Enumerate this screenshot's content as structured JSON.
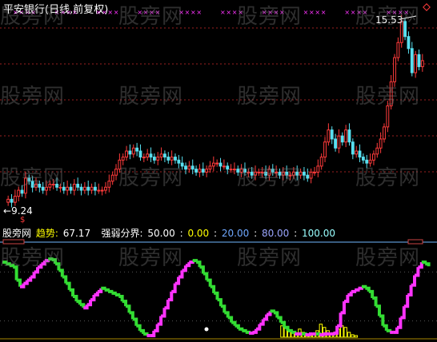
{
  "header": {
    "title": "平安银行(日线,前复权)"
  },
  "price": {
    "high_label": "15.53",
    "low_label": "9.24"
  },
  "indicator": {
    "source_label": "股旁网",
    "trend_label": "趋势:",
    "trend_value": "67.17",
    "bound_label": "强弱分界:",
    "levels": [
      "50.00",
      "0.00",
      "20.00",
      "80.00",
      "100.00"
    ],
    "sep": ":"
  },
  "watermark": "股旁网",
  "colors": {
    "up": "#ff3b3b",
    "down": "#58e0f0",
    "grid": "#9b1f1f",
    "magenta": "#ff33ff",
    "green": "#33dd33",
    "yellow": "#ffff00",
    "blue_level": "#6fa8ff",
    "cyan_level": "#99ffff"
  },
  "chart_data": [
    {
      "type": "candlestick",
      "title": "平安银行(日线,前复权)",
      "ylim": [
        9.0,
        16.0
      ],
      "annotations": [
        "15.53",
        "9.24"
      ],
      "close": [
        9.6,
        9.5,
        9.7,
        9.9,
        9.8,
        10.3,
        10.2,
        10.0,
        10.1,
        10.0,
        9.9,
        10.0,
        10.1,
        10.1,
        10.0,
        10.0,
        9.9,
        10.0,
        9.9,
        10.1,
        10.0,
        9.9,
        10.0,
        9.9,
        10.0,
        9.9,
        9.9,
        9.9,
        10.0,
        10.2,
        10.4,
        10.6,
        10.9,
        11.0,
        11.2,
        11.1,
        11.3,
        11.2,
        11.0,
        11.0,
        11.1,
        11.0,
        10.9,
        11.0,
        11.1,
        11.0,
        10.9,
        11.0,
        10.9,
        10.8,
        10.7,
        10.6,
        10.7,
        10.6,
        10.5,
        10.6,
        10.5,
        10.6,
        10.7,
        10.8,
        10.8,
        10.7,
        10.7,
        10.6,
        10.6,
        10.6,
        10.5,
        10.6,
        10.5,
        10.5,
        10.4,
        10.5,
        10.5,
        10.5,
        10.4,
        10.6,
        10.5,
        10.5,
        10.4,
        10.5,
        10.4,
        10.4,
        10.5,
        10.4,
        10.5,
        10.4,
        10.3,
        10.5,
        10.5,
        10.7,
        11.0,
        11.5,
        11.9,
        11.6,
        11.3,
        11.7,
        11.5,
        11.9,
        11.5,
        11.1,
        11.2,
        11.0,
        10.9,
        10.8,
        10.9,
        11.1,
        11.3,
        11.6,
        12.0,
        12.7,
        13.5,
        14.3,
        14.8,
        15.5,
        15.0,
        14.6,
        13.8,
        14.4,
        14.0,
        14.2
      ]
    },
    {
      "type": "line",
      "title": "趋势",
      "ylim": [
        0,
        100
      ],
      "series": [
        {
          "name": "趋势",
          "values": [
            92,
            90,
            88,
            86,
            70,
            62,
            66,
            70,
            74,
            80,
            86,
            90,
            94,
            96,
            95,
            90,
            82,
            74,
            66,
            58,
            50,
            44,
            40,
            36,
            40,
            46,
            52,
            56,
            60,
            58,
            56,
            54,
            52,
            50,
            44,
            38,
            30,
            22,
            14,
            8,
            4,
            2,
            2,
            8,
            16,
            26,
            36,
            46,
            56,
            66,
            74,
            82,
            88,
            92,
            94,
            92,
            86,
            78,
            70,
            62,
            54,
            46,
            38,
            30,
            24,
            18,
            14,
            10,
            8,
            6,
            5,
            6,
            10,
            16,
            22,
            28,
            32,
            30,
            24,
            18,
            12,
            8,
            6,
            4,
            4,
            4,
            3,
            4,
            4,
            4,
            3,
            4,
            4,
            4,
            5,
            14,
            30,
            44,
            52,
            56,
            58,
            60,
            62,
            60,
            56,
            48,
            38,
            26,
            14,
            8,
            6,
            6,
            12,
            24,
            38,
            52,
            64,
            76,
            86,
            92,
            90,
            87
          ]
        }
      ],
      "bars": [
        0,
        0,
        0,
        0,
        0,
        0,
        0,
        0,
        0,
        0,
        0,
        0,
        0,
        0,
        0,
        0,
        0,
        0,
        0,
        0,
        0,
        0,
        0,
        0,
        0,
        0,
        0,
        0,
        0,
        0,
        0,
        0,
        0,
        0,
        0,
        0,
        0,
        0,
        0,
        0,
        0,
        0,
        0,
        0,
        0,
        0,
        0,
        0,
        0,
        0,
        0,
        0,
        0,
        0,
        0,
        0,
        0,
        0,
        0,
        0,
        0,
        0,
        0,
        0,
        0,
        0,
        0,
        0,
        0,
        0,
        0,
        0,
        0,
        0,
        0,
        0,
        0,
        0,
        0,
        14,
        12,
        8,
        6,
        4,
        10,
        6,
        3,
        2,
        4,
        8,
        16,
        12,
        8,
        4,
        6,
        10,
        14,
        12,
        6,
        3,
        2,
        0,
        0,
        0,
        0,
        0,
        0,
        0,
        0,
        0,
        0,
        0,
        0,
        0,
        0,
        0,
        0,
        0,
        0,
        0,
        0,
        0
      ]
    }
  ]
}
